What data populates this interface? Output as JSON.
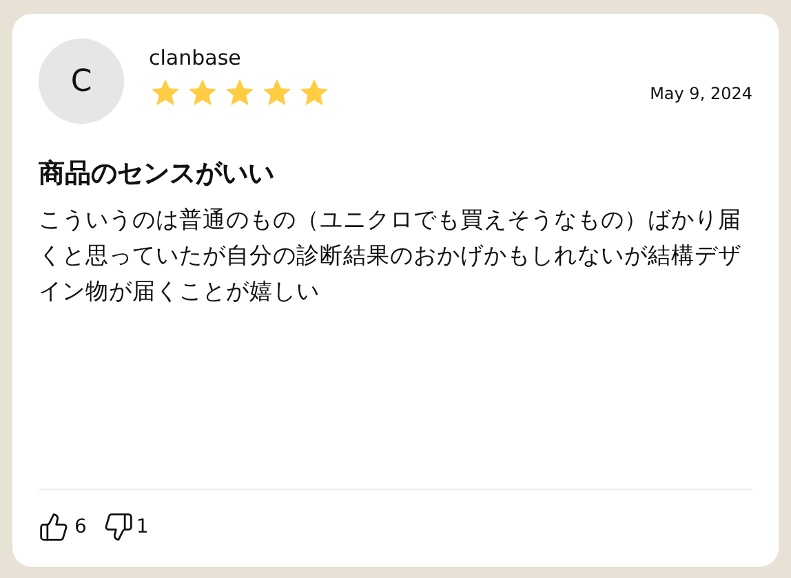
{
  "review": {
    "avatar_letter": "C",
    "author": "clanbase",
    "stars": 5,
    "date": "May 9, 2024",
    "title": "商品のセンスがいい",
    "body": "こういうのは普通のもの（ユニクロでも買えそうなもの）ばかり届くと思っていたが自分の診断結果のおかげかもしれないが結構デザイン物が届くことが嬉しい",
    "likes": "6",
    "dislikes": "1"
  }
}
